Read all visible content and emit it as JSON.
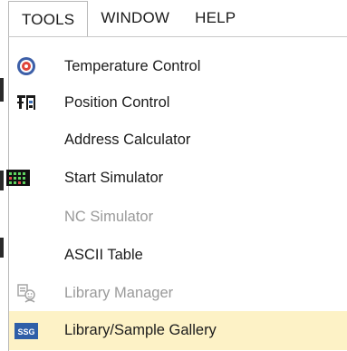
{
  "menubar": {
    "items": [
      {
        "label": "TOOLS",
        "active": true
      },
      {
        "label": "WINDOW",
        "active": false
      },
      {
        "label": "HELP",
        "active": false
      }
    ]
  },
  "tools_menu": {
    "items": [
      {
        "label": "Temperature Control",
        "icon": "temperature-control-icon",
        "enabled": true,
        "highlighted": false
      },
      {
        "label": "Position Control",
        "icon": "position-control-icon",
        "enabled": true,
        "highlighted": false
      },
      {
        "label": "Address Calculator",
        "icon": "",
        "enabled": true,
        "highlighted": false
      },
      {
        "label": "Start Simulator",
        "icon": "simulator-icon",
        "enabled": true,
        "highlighted": false
      },
      {
        "label": "NC Simulator",
        "icon": "",
        "enabled": false,
        "highlighted": false
      },
      {
        "label": "ASCII Table",
        "icon": "",
        "enabled": true,
        "highlighted": false
      },
      {
        "label": "Library Manager",
        "icon": "library-manager-icon",
        "enabled": false,
        "highlighted": false
      },
      {
        "label": "Library/Sample Gallery",
        "icon": "sample-gallery-icon",
        "enabled": true,
        "highlighted": true
      }
    ],
    "highlight_color": "#fdf2c6",
    "disabled_text_color": "#9a9a9a",
    "gallery_icon_text": "SSG"
  }
}
